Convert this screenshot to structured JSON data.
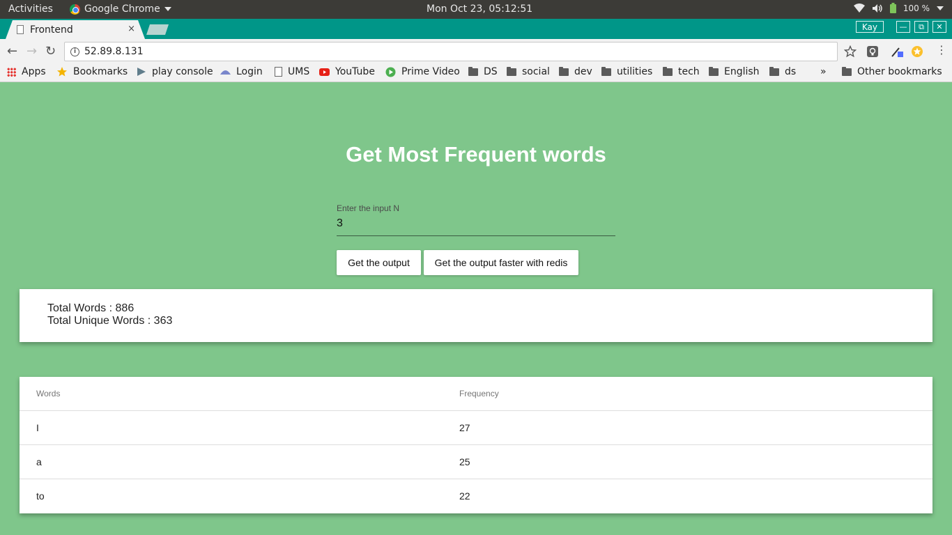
{
  "system_bar": {
    "activities": "Activities",
    "app_name": "Google Chrome",
    "clock": "Mon Oct 23, 05:12:51",
    "battery": "100 %"
  },
  "browser": {
    "tab_title": "Frontend",
    "tab_close": "×",
    "profile": "Kay",
    "url": "52.89.8.131",
    "bookmarks": [
      {
        "label": "Apps",
        "icon": "apps-grid-icon"
      },
      {
        "label": "Bookmarks",
        "icon": "star-icon"
      },
      {
        "label": "play console",
        "icon": "play-console-icon"
      },
      {
        "label": "Login",
        "icon": "login-icon"
      },
      {
        "label": "UMS",
        "icon": "page-icon"
      },
      {
        "label": "YouTube",
        "icon": "youtube-icon"
      },
      {
        "label": "Prime Video",
        "icon": "prime-video-icon"
      },
      {
        "label": "DS",
        "icon": "folder-icon"
      },
      {
        "label": "social",
        "icon": "folder-icon"
      },
      {
        "label": "dev",
        "icon": "folder-icon"
      },
      {
        "label": "utilities",
        "icon": "folder-icon"
      },
      {
        "label": "tech",
        "icon": "folder-icon"
      },
      {
        "label": "English",
        "icon": "folder-icon"
      },
      {
        "label": "ds",
        "icon": "folder-icon"
      }
    ],
    "overflow": "»",
    "other_bookmarks": "Other bookmarks"
  },
  "page": {
    "title": "Get Most Frequent words",
    "input_label": "Enter the input N",
    "input_value": "3",
    "button_output": "Get the output",
    "button_redis": "Get the output faster with redis",
    "total_words": "Total Words : 886",
    "total_unique_words": "Total Unique Words : 363",
    "table": {
      "headers": [
        "Words",
        "Frequency"
      ],
      "rows": [
        [
          "I",
          "27"
        ],
        [
          "a",
          "25"
        ],
        [
          "to",
          "22"
        ]
      ]
    }
  },
  "colors": {
    "page_background": "#7fc68b",
    "tab_strip": "#009688",
    "card": "#ffffff"
  }
}
